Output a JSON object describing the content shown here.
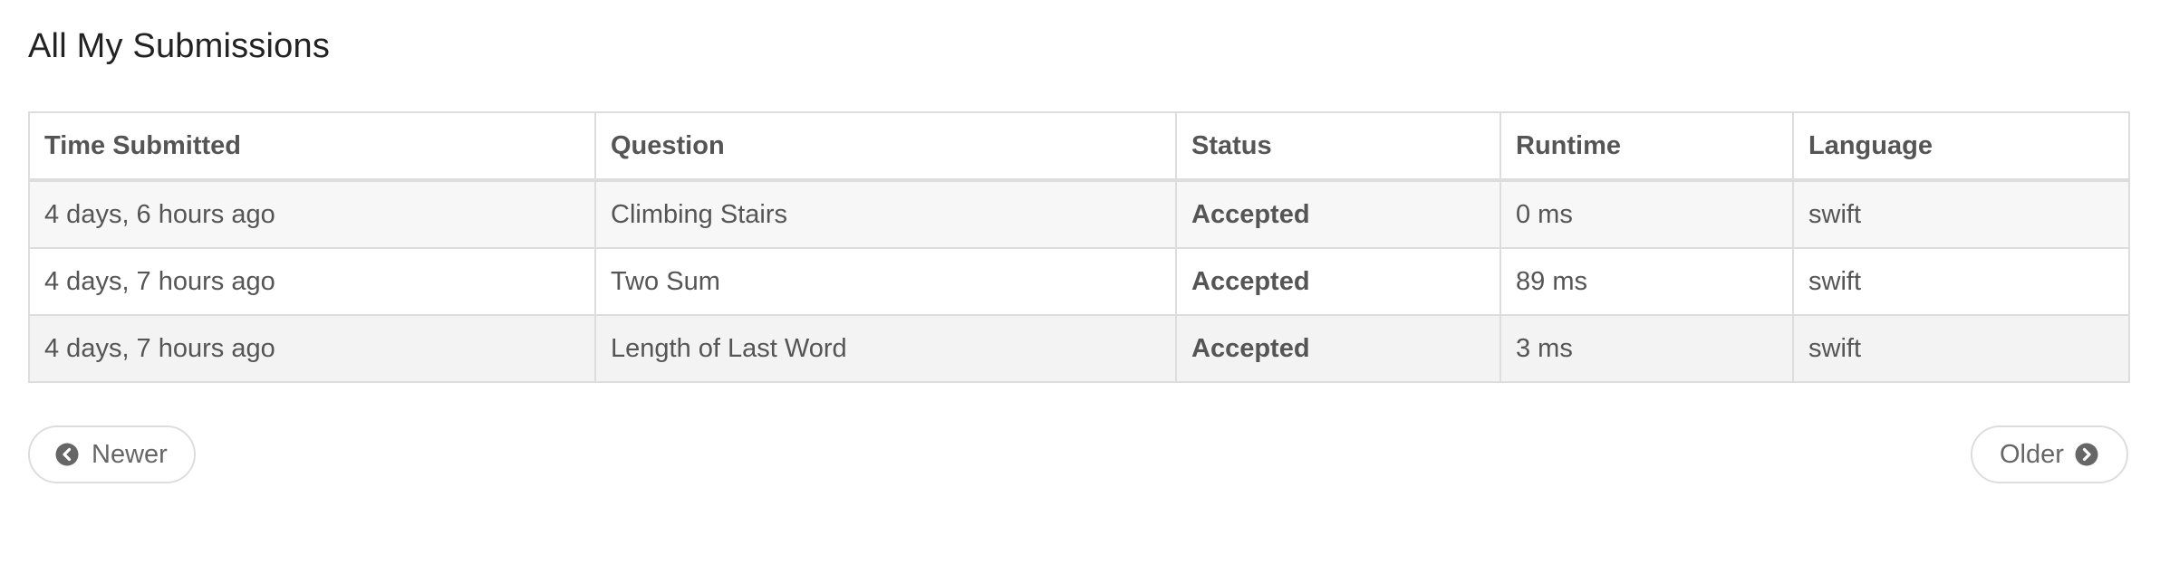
{
  "page": {
    "title": "All My Submissions"
  },
  "table": {
    "columns": [
      "Time Submitted",
      "Question",
      "Status",
      "Runtime",
      "Language"
    ],
    "rows": [
      {
        "time": "4 days, 6 hours ago",
        "question": "Climbing Stairs",
        "status": "Accepted",
        "runtime": "0 ms",
        "language": "swift"
      },
      {
        "time": "4 days, 7 hours ago",
        "question": "Two Sum",
        "status": "Accepted",
        "runtime": "89 ms",
        "language": "swift"
      },
      {
        "time": "4 days, 7 hours ago",
        "question": "Length of Last Word",
        "status": "Accepted",
        "runtime": "3 ms",
        "language": "swift"
      }
    ]
  },
  "pagination": {
    "newer_label": "Newer",
    "older_label": "Older",
    "newer_icon": "chevron-circle-left-icon",
    "older_icon": "chevron-circle-right-icon"
  },
  "colors": {
    "accepted": "#5c9e3e",
    "border": "#dddddd",
    "stripe": "#f7f7f7"
  }
}
